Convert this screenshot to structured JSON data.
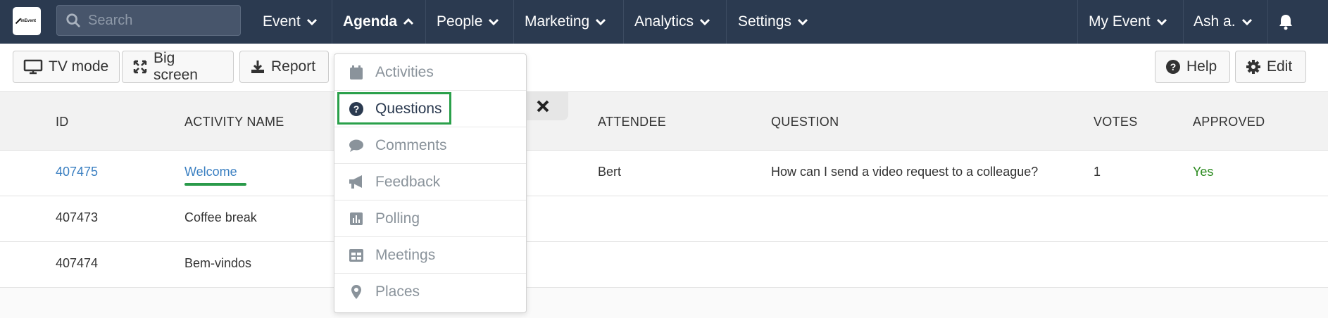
{
  "nav": {
    "search_placeholder": "Search",
    "items": [
      {
        "label": "Event"
      },
      {
        "label": "Agenda"
      },
      {
        "label": "People"
      },
      {
        "label": "Marketing"
      },
      {
        "label": "Analytics"
      },
      {
        "label": "Settings"
      }
    ],
    "right": {
      "event": "My Event",
      "user": "Ash a."
    }
  },
  "toolbar": {
    "tv_mode": "TV mode",
    "big_screen": "Big screen",
    "report": "Report",
    "help": "Help",
    "edit": "Edit"
  },
  "agenda_menu": {
    "items": [
      {
        "label": "Activities",
        "icon": "calendar-icon"
      },
      {
        "label": "Questions",
        "icon": "question-circle-icon"
      },
      {
        "label": "Comments",
        "icon": "comment-icon"
      },
      {
        "label": "Feedback",
        "icon": "bullhorn-icon"
      },
      {
        "label": "Polling",
        "icon": "bar-chart-icon"
      },
      {
        "label": "Meetings",
        "icon": "table-icon"
      },
      {
        "label": "Places",
        "icon": "map-marker-icon"
      }
    ]
  },
  "table": {
    "headers": {
      "id": "ID",
      "activity": "ACTIVITY NAME",
      "attendee": "ATTENDEE",
      "question": "QUESTION",
      "votes": "VOTES",
      "approved": "APPROVED"
    },
    "rows": [
      {
        "id": "407475",
        "activity": "Welcome",
        "attendee": "Bert",
        "question": "How can I send a video request to a colleague?",
        "votes": "1",
        "approved": "Yes"
      },
      {
        "id": "407473",
        "activity": "Coffee break",
        "attendee": "",
        "question": "",
        "votes": "",
        "approved": ""
      },
      {
        "id": "407474",
        "activity": "Bem-vindos",
        "attendee": "",
        "question": "",
        "votes": "",
        "approved": ""
      }
    ]
  },
  "colors": {
    "nav_bg": "#2b3a50",
    "link": "#3a7fc1",
    "approved": "#2a8a1e",
    "highlight": "#2aa04a"
  }
}
